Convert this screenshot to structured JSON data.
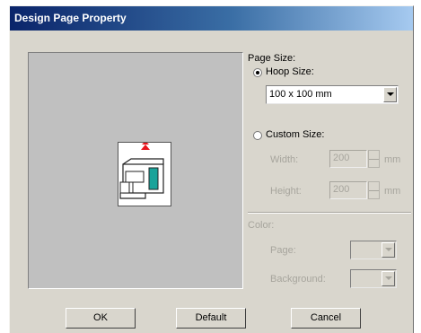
{
  "dialog": {
    "title": "Design Page Property",
    "page_size": {
      "group_label": "Page Size:",
      "hoop_size_label": "Hoop Size:",
      "hoop_size_selected": true,
      "hoop_size_value": "100 x 100 mm",
      "custom_size_label": "Custom Size:",
      "custom_size_selected": false,
      "width_label": "Width:",
      "width_value": "200",
      "height_label": "Height:",
      "height_value": "200",
      "unit_label": "mm"
    },
    "color": {
      "group_label": "Color:",
      "page_label": "Page:",
      "background_label": "Background:"
    },
    "buttons": {
      "ok": "OK",
      "default": "Default",
      "cancel": "Cancel"
    },
    "colors": {
      "title_bar_start": "#0a246a",
      "title_bar_end": "#a6caf0",
      "marker_red": "#e8141c",
      "machine_teal": "#1aa39a"
    }
  }
}
